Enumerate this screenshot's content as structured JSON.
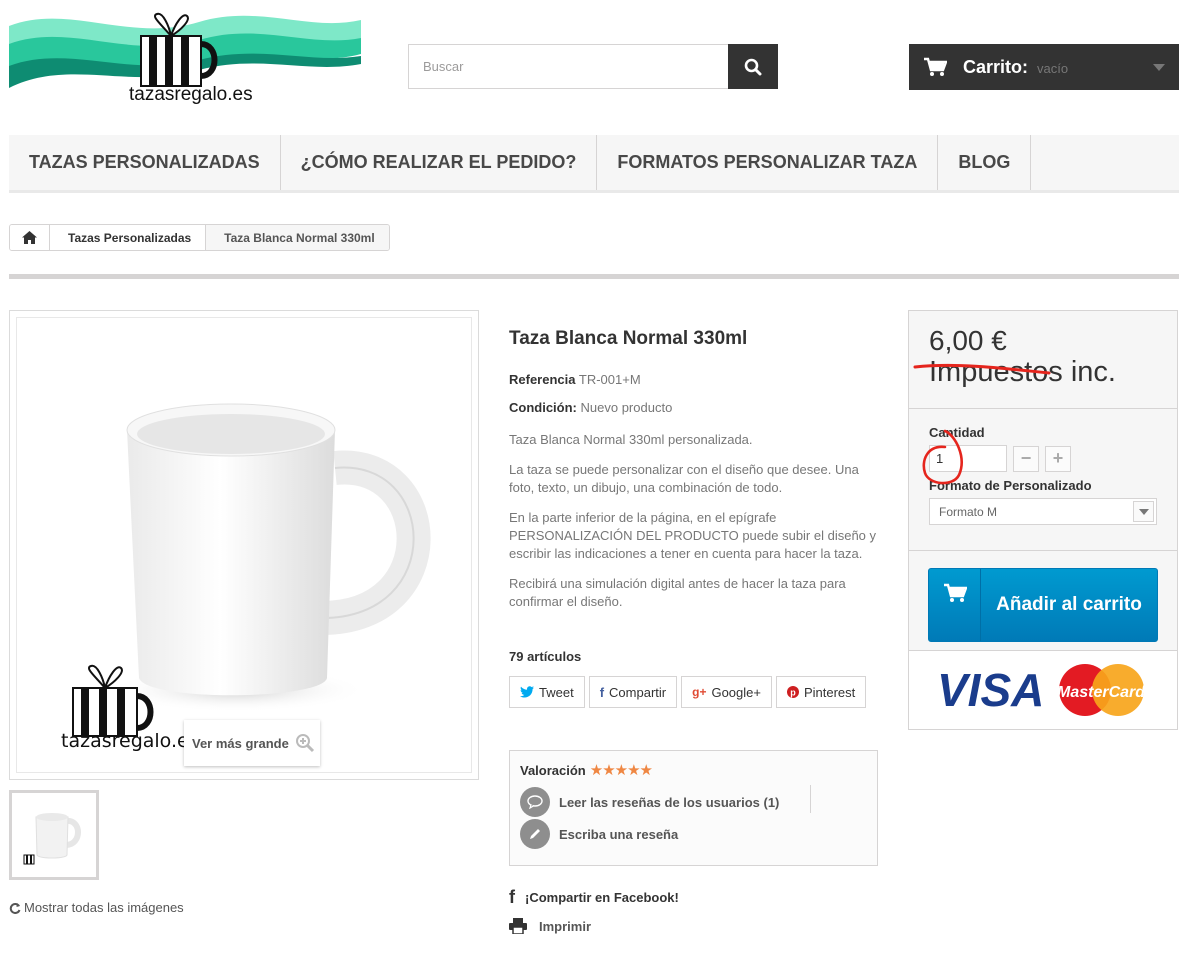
{
  "header": {
    "logo_text": "tazasregalo.es",
    "search_placeholder": "Buscar",
    "cart_label": "Carrito:",
    "cart_status": "vacío"
  },
  "menu": {
    "items": [
      {
        "label": "TAZAS PERSONALIZADAS"
      },
      {
        "label": "¿CÓMO REALIZAR EL PEDIDO?"
      },
      {
        "label": "FORMATOS PERSONALIZAR TAZA"
      },
      {
        "label": "BLOG"
      }
    ]
  },
  "breadcrumb": {
    "category": "Tazas Personalizadas",
    "current": "Taza Blanca Normal 330ml"
  },
  "gallery": {
    "zoom_label": "Ver más grande",
    "watermark_text": "tazasregalo.es",
    "show_all": "Mostrar todas las imágenes"
  },
  "product": {
    "title": "Taza Blanca Normal 330ml",
    "reference_label": "Referencia",
    "reference_value": "TR-001+M",
    "condition_label": "Condición:",
    "condition_value": "Nuevo producto",
    "description": [
      "Taza Blanca Normal 330ml personalizada.",
      "La taza se puede personalizar con el diseño que desee. Una foto, texto, un dibujo, una combinación de todo.",
      "En la parte inferior de la página, en el epígrafe PERSONALIZACIÓN DEL PRODUCTO puede subir el diseño y escribir las indicaciones a tener en cuenta para hacer la taza.",
      "Recibirá una simulación digital antes de hacer la taza para confirmar el diseño."
    ],
    "stock": "79 artículos"
  },
  "social": {
    "tweet": "Tweet",
    "share": "Compartir",
    "google": "Google+",
    "pinterest": "Pinterest"
  },
  "rating": {
    "label": "Valoración",
    "stars": 5,
    "stars_text": "★★★★★",
    "read_reviews": "Leer las reseñas de los usuarios (1)",
    "write_review": "Escriba una reseña"
  },
  "actions": {
    "fb_share": "¡Compartir en Facebook!",
    "print": "Imprimir"
  },
  "buy": {
    "price": "6,00 €",
    "tax": "Impuestos inc.",
    "qty_label": "Cantidad",
    "qty_value": "1",
    "format_label": "Formato de Personalizado",
    "format_value": "Formato M",
    "add_to_cart": "Añadir al carrito",
    "visa_text": "VISA",
    "mastercard_text": "MasterCard"
  },
  "colors": {
    "accent_blue": "#0099d4",
    "dark": "#333333",
    "annotation_red": "#e5251d",
    "star": "#ef8743",
    "logo_teal": "#2fbf9a"
  }
}
